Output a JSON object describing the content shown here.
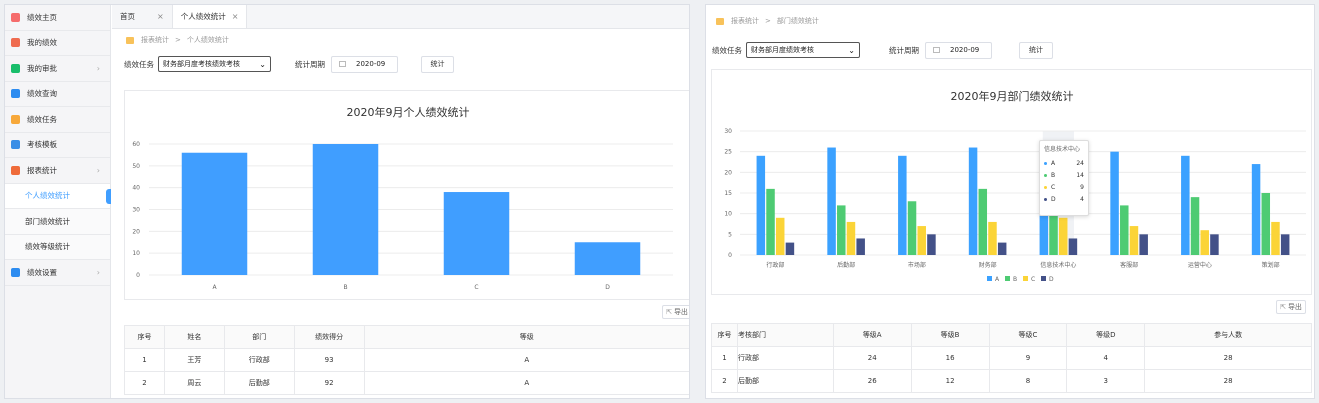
{
  "left": {
    "sidebar": {
      "items": [
        {
          "label": "绩效主页",
          "color": "#f56c6c",
          "arrow": false
        },
        {
          "label": "我的绩效",
          "color": "#ef6b4f",
          "arrow": false
        },
        {
          "label": "我的审批",
          "color": "#19be6b",
          "arrow": true
        },
        {
          "label": "绩效查询",
          "color": "#2d8cf0",
          "arrow": false
        },
        {
          "label": "绩效任务",
          "color": "#f7a83a",
          "arrow": false
        },
        {
          "label": "考核模板",
          "color": "#3a8ee6",
          "arrow": false
        },
        {
          "label": "报表统计",
          "color": "#ef6b3a",
          "arrow": true
        },
        {
          "label": "个人绩效统计",
          "sub": true,
          "active": true
        },
        {
          "label": "部门绩效统计",
          "sub": true
        },
        {
          "label": "绩效等级统计",
          "sub": true
        },
        {
          "label": "绩效设置",
          "color": "#2d8cf0",
          "arrow": true
        }
      ],
      "arrow_glyph": "›"
    },
    "tabs": [
      {
        "label": "首页",
        "close": "×"
      },
      {
        "label": "个人绩效统计",
        "close": "×",
        "active": true
      }
    ],
    "breadcrumb": {
      "root": "报表统计",
      "sep": ">",
      "current": "个人绩效统计"
    },
    "filter": {
      "task_label": "绩效任务",
      "task_value": "财务部月度考核绩效考核",
      "period_label": "统计周期",
      "period_value": "2020-09",
      "btn": "统计"
    },
    "export": "导出",
    "table": {
      "headers": [
        "序号",
        "姓名",
        "部门",
        "绩效得分",
        "等级"
      ],
      "rows": [
        [
          "1",
          "王芳",
          "行政部",
          "93",
          "A"
        ],
        [
          "2",
          "周云",
          "后勤部",
          "92",
          "A"
        ]
      ]
    }
  },
  "right": {
    "breadcrumb": {
      "root": "报表统计",
      "sep": ">",
      "current": "部门绩效统计"
    },
    "filter": {
      "task_label": "绩效任务",
      "task_value": "财务部月度绩效考核",
      "period_label": "统计周期",
      "period_value": "2020-09",
      "btn": "统计"
    },
    "export": "导出",
    "tooltip": {
      "title": "信息技术中心",
      "rows": [
        [
          "A",
          "24"
        ],
        [
          "B",
          "14"
        ],
        [
          "C",
          "9"
        ],
        [
          "D",
          "4"
        ]
      ]
    },
    "table": {
      "headers": [
        "序号",
        "考核部门",
        "等级A",
        "等级B",
        "等级C",
        "等级D",
        "参与人数"
      ],
      "rows": [
        [
          "1",
          "行政部",
          "24",
          "16",
          "9",
          "4",
          "28"
        ],
        [
          "2",
          "后勤部",
          "26",
          "12",
          "8",
          "3",
          "28"
        ]
      ]
    }
  },
  "chart_data": [
    {
      "type": "bar",
      "title": "2020年9月个人绩效统计",
      "categories": [
        "A",
        "B",
        "C",
        "D"
      ],
      "values": [
        56,
        60,
        38,
        15
      ],
      "ylim": [
        0,
        60
      ],
      "yticks": [
        "0",
        "10",
        "20",
        "30",
        "40",
        "50",
        "60"
      ],
      "color": "#409eff",
      "grid": true
    },
    {
      "type": "bar",
      "title": "2020年9月部门绩效统计",
      "categories": [
        "行政部",
        "后勤部",
        "市场部",
        "财务部",
        "信息技术中心",
        "客服部",
        "运营中心",
        "策划部"
      ],
      "series": [
        {
          "name": "A",
          "color": "#3ba1ff",
          "values": [
            24,
            26,
            24,
            26,
            24,
            25,
            24,
            22
          ]
        },
        {
          "name": "B",
          "color": "#4ecb73",
          "values": [
            16,
            12,
            13,
            16,
            14,
            12,
            14,
            15
          ]
        },
        {
          "name": "C",
          "color": "#fbd437",
          "values": [
            9,
            8,
            7,
            8,
            9,
            7,
            6,
            8
          ]
        },
        {
          "name": "D",
          "color": "#435188",
          "values": [
            3,
            4,
            5,
            3,
            4,
            5,
            5,
            5
          ]
        }
      ],
      "ylim": [
        0,
        30
      ],
      "yticks": [
        "0",
        "5",
        "10",
        "15",
        "20",
        "25",
        "30"
      ],
      "legend": "bottom",
      "grid": true
    }
  ]
}
